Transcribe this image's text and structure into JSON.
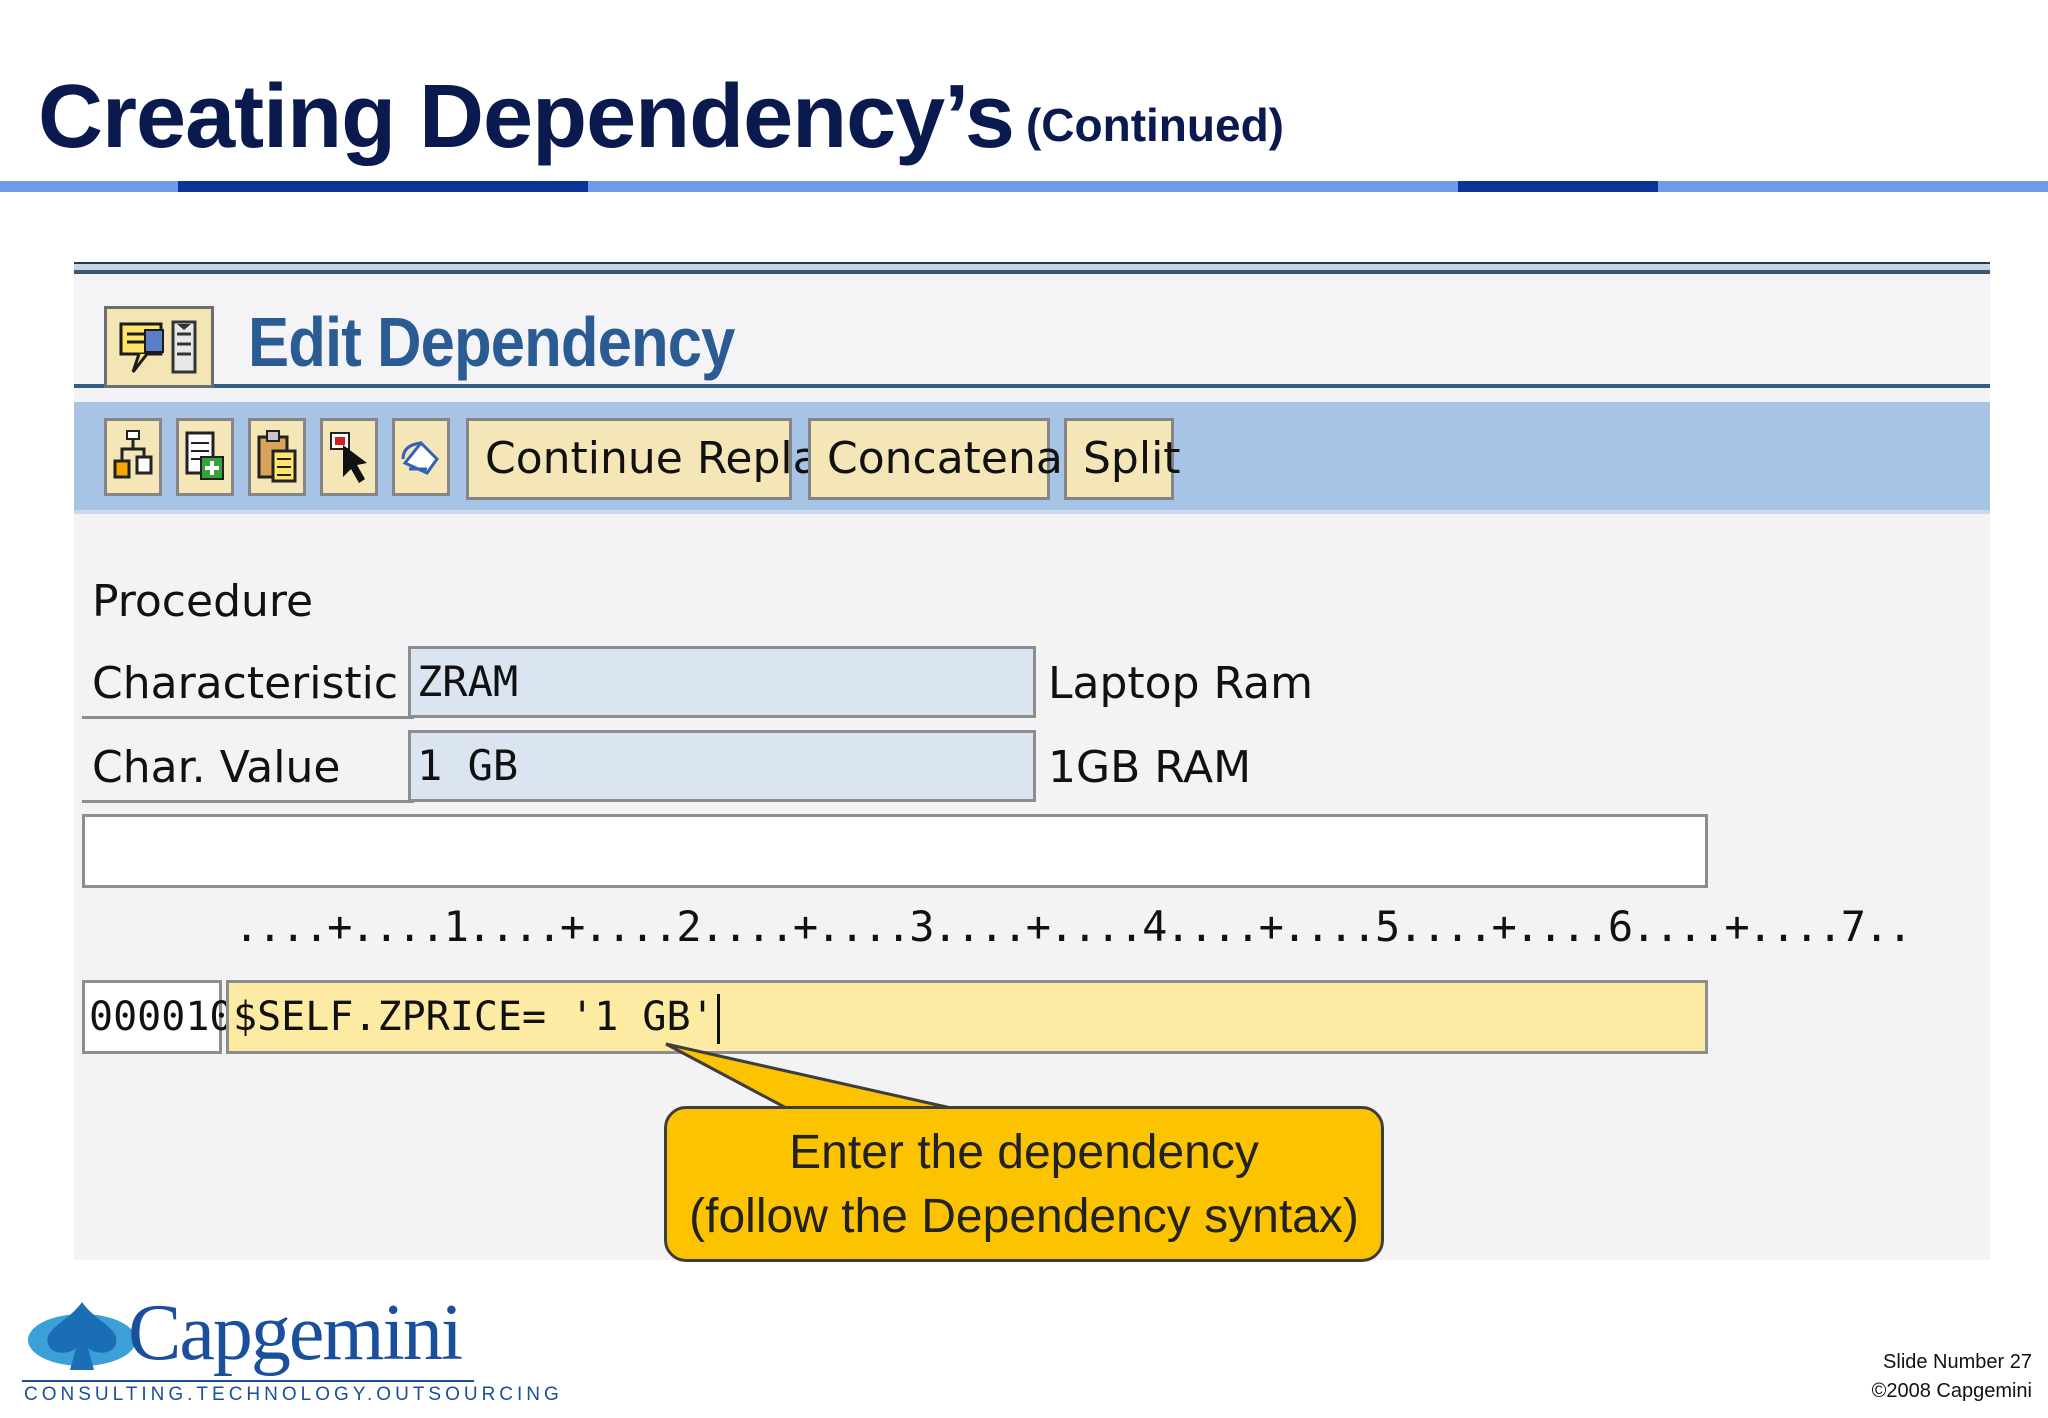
{
  "slide": {
    "title": "Creating Dependency’s",
    "title_suffix": "(Continued)"
  },
  "screen": {
    "title": "Edit Dependency",
    "toolbar": {
      "icons": [
        "structure-icon",
        "insert-line-icon",
        "paste-icon",
        "select-pointer-icon",
        "undo-icon"
      ],
      "buttons": {
        "continue_replace": "Continue Replace",
        "concatenate": "Concatenate",
        "split": "Split"
      }
    },
    "form": {
      "procedure_label": "Procedure",
      "characteristic_label": "Characteristic",
      "characteristic_value": "ZRAM",
      "characteristic_desc": "Laptop Ram",
      "char_value_label": "Char. Value",
      "char_value_value": "1 GB",
      "char_value_desc": "1GB RAM"
    },
    "editor": {
      "ruler": "....+....1....+....2....+....3....+....4....+....5....+....6....+....7..",
      "line_number": "000010",
      "code": "$SELF.ZPRICE= '1 GB'"
    }
  },
  "callout": {
    "line1": "Enter the dependency",
    "line2": "(follow the Dependency syntax)",
    "color": "#fcc400"
  },
  "footer": {
    "slide_number": "Slide Number 27",
    "copyright": "©2008 Capgemini"
  },
  "logo": {
    "name": "Capgemini",
    "tagline": "CONSULTING.TECHNOLOGY.OUTSOURCING"
  }
}
